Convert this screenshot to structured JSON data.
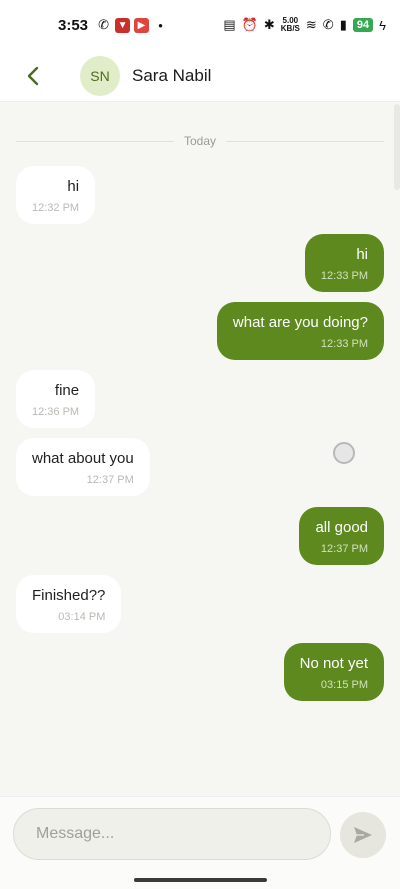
{
  "status_bar": {
    "time": "3:53",
    "net_speed_value": "5.00",
    "net_speed_unit": "KB/S",
    "battery": "94"
  },
  "header": {
    "back_icon": "chevron-left-icon",
    "avatar_initials": "SN",
    "contact_name": "Sara Nabil"
  },
  "chat": {
    "day_label": "Today",
    "messages": [
      {
        "direction": "in",
        "text": "hi",
        "time": "12:32 PM"
      },
      {
        "direction": "out",
        "text": "hi",
        "time": "12:33 PM"
      },
      {
        "direction": "out",
        "text": "what are you doing?",
        "time": "12:33 PM"
      },
      {
        "direction": "in",
        "text": "fine",
        "time": "12:36 PM"
      },
      {
        "direction": "in",
        "text": "what about you",
        "time": "12:37 PM"
      },
      {
        "direction": "out",
        "text": "all good",
        "time": "12:37 PM"
      },
      {
        "direction": "in",
        "text": "Finished??",
        "time": "03:14 PM"
      },
      {
        "direction": "out",
        "text": "No not yet",
        "time": "03:15 PM"
      }
    ]
  },
  "composer": {
    "placeholder": "Message...",
    "send_icon": "send-icon"
  },
  "colors": {
    "outgoing_bubble": "#5d891f",
    "incoming_bubble": "#ffffff",
    "background": "#f6f6f2",
    "accent": "#4e6b1f"
  }
}
